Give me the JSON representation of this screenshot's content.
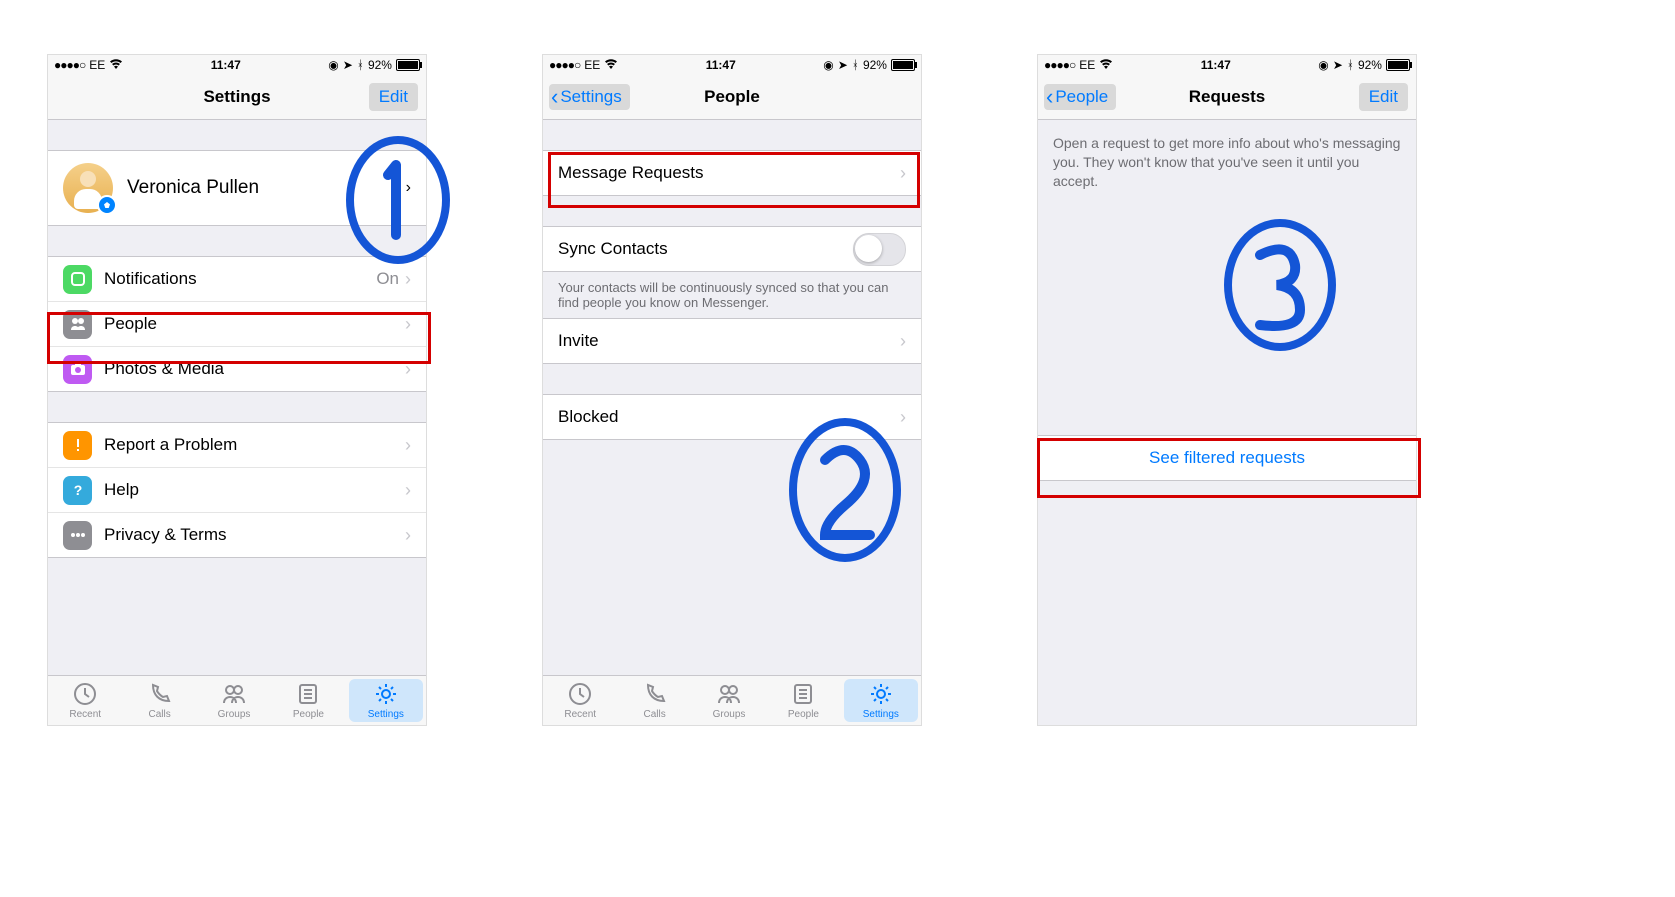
{
  "status": {
    "carrier_dots": "●●●●○",
    "carrier": "EE",
    "time": "11:47",
    "battery_pct": "92%"
  },
  "screen1": {
    "nav": {
      "title": "Settings",
      "edit": "Edit"
    },
    "profile_name": "Veronica Pullen",
    "rows": {
      "notifications": {
        "label": "Notifications",
        "value": "On"
      },
      "people": {
        "label": "People"
      },
      "photos": {
        "label": "Photos & Media"
      },
      "report": {
        "label": "Report a Problem"
      },
      "help": {
        "label": "Help"
      },
      "privacy": {
        "label": "Privacy & Terms"
      }
    }
  },
  "screen2": {
    "nav": {
      "title": "People",
      "back": "Settings"
    },
    "rows": {
      "message_requests": {
        "label": "Message Requests"
      },
      "sync": {
        "label": "Sync Contacts"
      },
      "sync_caption": "Your contacts will be continuously synced so that you can find people you know on Messenger.",
      "invite": {
        "label": "Invite"
      },
      "blocked": {
        "label": "Blocked"
      }
    }
  },
  "screen3": {
    "nav": {
      "title": "Requests",
      "back": "People",
      "edit": "Edit"
    },
    "info": "Open a request to get more info about who's messaging you. They won't know that you've seen it until you accept.",
    "filtered_link": "See filtered requests"
  },
  "tabs": {
    "recent": "Recent",
    "calls": "Calls",
    "groups": "Groups",
    "people": "People",
    "settings": "Settings"
  },
  "annotations": {
    "n1": "1",
    "n2": "2",
    "n3": "3"
  }
}
